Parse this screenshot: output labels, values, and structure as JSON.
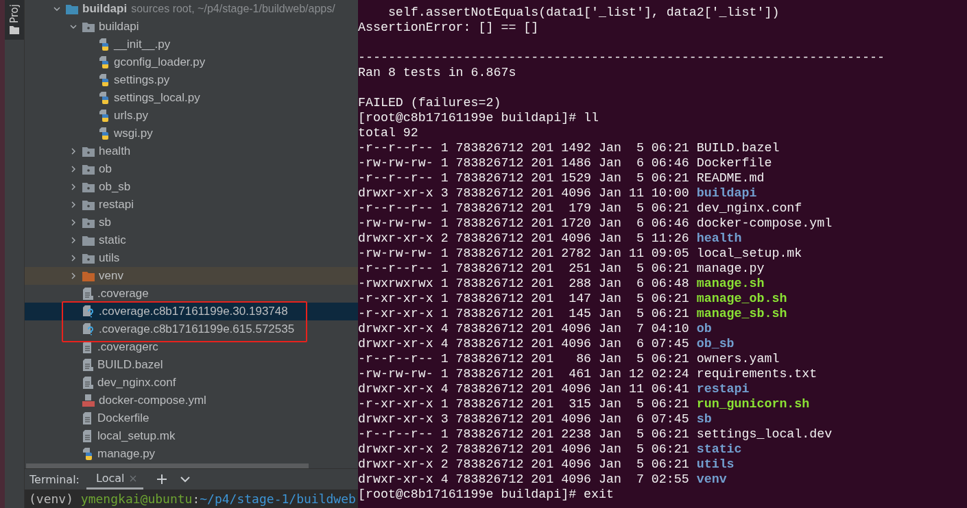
{
  "tool_strip": {
    "label": "Proj"
  },
  "project_tree": {
    "name": "buildapi",
    "note": "sources root, ~/p4/stage-1/buildweb/apps/",
    "kind": "root",
    "expanded": true,
    "selected": false,
    "children": [
      {
        "name": "buildapi",
        "kind": "package",
        "expanded": true,
        "selected": false,
        "children": [
          {
            "name": "__init__.py",
            "kind": "python",
            "selected": false
          },
          {
            "name": "gconfig_loader.py",
            "kind": "python",
            "selected": false
          },
          {
            "name": "settings.py",
            "kind": "python",
            "selected": false
          },
          {
            "name": "settings_local.py",
            "kind": "python",
            "selected": false
          },
          {
            "name": "urls.py",
            "kind": "python",
            "selected": false
          },
          {
            "name": "wsgi.py",
            "kind": "python",
            "selected": false
          }
        ]
      },
      {
        "name": "health",
        "kind": "package",
        "expanded": false,
        "selected": false
      },
      {
        "name": "ob",
        "kind": "package",
        "expanded": false,
        "selected": false
      },
      {
        "name": "ob_sb",
        "kind": "package",
        "expanded": false,
        "selected": false
      },
      {
        "name": "restapi",
        "kind": "package",
        "expanded": false,
        "selected": false
      },
      {
        "name": "sb",
        "kind": "package",
        "expanded": false,
        "selected": false
      },
      {
        "name": "static",
        "kind": "folder",
        "expanded": false,
        "selected": false
      },
      {
        "name": "utils",
        "kind": "package",
        "expanded": false,
        "selected": false
      },
      {
        "name": "venv",
        "kind": "excluded",
        "expanded": false,
        "selected": false
      },
      {
        "name": ".coverage",
        "kind": "locked",
        "selected": false
      },
      {
        "name": ".coverage.c8b17161199e.30.193748",
        "kind": "unknown",
        "selected": true,
        "marked": true
      },
      {
        "name": ".coverage.c8b17161199e.615.572535",
        "kind": "unknown",
        "selected": false,
        "marked": true
      },
      {
        "name": ".coveragerc",
        "kind": "text",
        "selected": false
      },
      {
        "name": "BUILD.bazel",
        "kind": "locked",
        "selected": false
      },
      {
        "name": "dev_nginx.conf",
        "kind": "locked",
        "selected": false
      },
      {
        "name": "docker-compose.yml",
        "kind": "yml",
        "selected": false
      },
      {
        "name": "Dockerfile",
        "kind": "text",
        "selected": false
      },
      {
        "name": "local_setup.mk",
        "kind": "text",
        "selected": false
      },
      {
        "name": "manage.py",
        "kind": "python",
        "selected": false
      }
    ]
  },
  "terminal_tabs": {
    "label": "Terminal:",
    "tabs": [
      {
        "label": "Local",
        "selected": true
      }
    ]
  },
  "local_prompt": [
    {
      "text": "(venv) ",
      "kind": "plain"
    },
    {
      "text": "ymengkai@ubuntu",
      "kind": "user"
    },
    {
      "text": ":",
      "kind": "plain"
    },
    {
      "text": "~/p4/stage-1/buildweb",
      "kind": "path"
    }
  ],
  "terminal_lines": [
    {
      "kind": "text",
      "text": "    self.assertNotEquals(data1['_list'], data2['_list'])"
    },
    {
      "kind": "text",
      "text": "AssertionError: [] == []"
    },
    {
      "kind": "blank"
    },
    {
      "kind": "text",
      "text": "----------------------------------------------------------------------"
    },
    {
      "kind": "text",
      "text": "Ran 8 tests in 6.867s"
    },
    {
      "kind": "blank"
    },
    {
      "kind": "text",
      "text": "FAILED (failures=2)"
    },
    {
      "kind": "text",
      "text": "[root@c8b17161199e buildapi]# ll"
    },
    {
      "kind": "text",
      "text": "total 92"
    }
  ],
  "listing": [
    {
      "meta": "-r--r--r-- 1 783826712 201 1492 Jan  5 06:21",
      "name": "BUILD.bazel",
      "kind": "file"
    },
    {
      "meta": "-rw-rw-rw- 1 783826712 201 1486 Jan  6 06:46",
      "name": "Dockerfile",
      "kind": "file"
    },
    {
      "meta": "-r--r--r-- 1 783826712 201 1529 Jan  5 06:21",
      "name": "README.md",
      "kind": "file"
    },
    {
      "meta": "drwxr-xr-x 3 783826712 201 4096 Jan 11 10:00",
      "name": "buildapi",
      "kind": "dir"
    },
    {
      "meta": "-r--r--r-- 1 783826712 201  179 Jan  5 06:21",
      "name": "dev_nginx.conf",
      "kind": "file"
    },
    {
      "meta": "-rw-rw-rw- 1 783826712 201 1720 Jan  6 06:46",
      "name": "docker-compose.yml",
      "kind": "file"
    },
    {
      "meta": "drwxr-xr-x 2 783826712 201 4096 Jan  5 11:26",
      "name": "health",
      "kind": "dir"
    },
    {
      "meta": "-rw-rw-rw- 1 783826712 201 2782 Jan 11 09:05",
      "name": "local_setup.mk",
      "kind": "file"
    },
    {
      "meta": "-r--r--r-- 1 783826712 201  251 Jan  5 06:21",
      "name": "manage.py",
      "kind": "file"
    },
    {
      "meta": "-rwxrwxrwx 1 783826712 201  288 Jan  6 06:48",
      "name": "manage.sh",
      "kind": "exec"
    },
    {
      "meta": "-r-xr-xr-x 1 783826712 201  147 Jan  5 06:21",
      "name": "manage_ob.sh",
      "kind": "exec"
    },
    {
      "meta": "-r-xr-xr-x 1 783826712 201  145 Jan  5 06:21",
      "name": "manage_sb.sh",
      "kind": "exec"
    },
    {
      "meta": "drwxr-xr-x 4 783826712 201 4096 Jan  7 04:10",
      "name": "ob",
      "kind": "dir"
    },
    {
      "meta": "drwxr-xr-x 4 783826712 201 4096 Jan  6 07:45",
      "name": "ob_sb",
      "kind": "dir"
    },
    {
      "meta": "-r--r--r-- 1 783826712 201   86 Jan  5 06:21",
      "name": "owners.yaml",
      "kind": "file"
    },
    {
      "meta": "-rw-rw-rw- 1 783826712 201  461 Jan 12 02:24",
      "name": "requirements.txt",
      "kind": "file"
    },
    {
      "meta": "drwxr-xr-x 4 783826712 201 4096 Jan 11 06:41",
      "name": "restapi",
      "kind": "dir"
    },
    {
      "meta": "-r-xr-xr-x 1 783826712 201  315 Jan  5 06:21",
      "name": "run_gunicorn.sh",
      "kind": "exec"
    },
    {
      "meta": "drwxr-xr-x 3 783826712 201 4096 Jan  6 07:45",
      "name": "sb",
      "kind": "dir"
    },
    {
      "meta": "-r--r--r-- 1 783826712 201 2238 Jan  5 06:21",
      "name": "settings_local.dev",
      "kind": "file"
    },
    {
      "meta": "drwxr-xr-x 2 783826712 201 4096 Jan  5 06:21",
      "name": "static",
      "kind": "dir"
    },
    {
      "meta": "drwxr-xr-x 2 783826712 201 4096 Jan  5 06:21",
      "name": "utils",
      "kind": "dir"
    },
    {
      "meta": "drwxr-xr-x 4 783826712 201 4096 Jan  7 02:55",
      "name": "venv",
      "kind": "dir"
    }
  ],
  "final_prompt": {
    "text": "[root@c8b17161199e buildapi]# exit"
  }
}
